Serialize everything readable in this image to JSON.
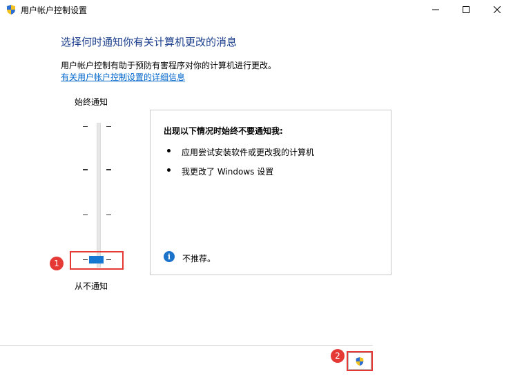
{
  "window": {
    "title": "用户帐户控制设置"
  },
  "main": {
    "heading": "选择何时通知你有关计算机更改的消息",
    "description": "用户帐户控制有助于预防有害程序对你的计算机进行更改。",
    "link": "有关用户帐户控制设置的详细信息"
  },
  "slider": {
    "top_label": "始终通知",
    "bottom_label": "从不通知",
    "level": 0,
    "levels": 4
  },
  "panel": {
    "title": "出现以下情况时始终不要通知我:",
    "items": [
      "应用尝试安装软件或更改我的计算机",
      "我更改了 Windows 设置"
    ],
    "info_text": "不推荐。"
  },
  "annotations": {
    "badge1": "1",
    "badge2": "2"
  },
  "colors": {
    "highlight": "#e53935",
    "accent": "#1677d2",
    "heading": "#1a3e8c",
    "link": "#0066cc"
  },
  "icons": {
    "app": "uac-shield-icon",
    "button": "uac-shield-icon",
    "info": "info-icon"
  }
}
